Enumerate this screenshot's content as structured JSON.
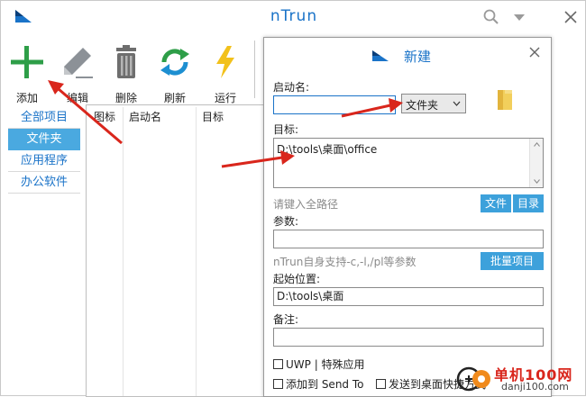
{
  "app": {
    "title": "nTrun"
  },
  "titlebar_icons": [
    "search-icon",
    "dropdown-icon",
    "close-icon"
  ],
  "toolbar": {
    "add_label": "添加",
    "edit_label": "编辑",
    "delete_label": "删除",
    "refresh_label": "刷新",
    "run_label": "运行"
  },
  "sidebar": {
    "items": [
      {
        "label": "全部项目"
      },
      {
        "label": "文件夹"
      },
      {
        "label": "应用程序"
      },
      {
        "label": "办公软件"
      }
    ]
  },
  "list": {
    "columns": [
      "图标",
      "启动名",
      "目标"
    ]
  },
  "dialog": {
    "title": "新建",
    "name_label": "启动名:",
    "name_value": "",
    "type_value": "文件夹",
    "target_label": "目标:",
    "target_value": "D:\\tools\\桌面\\office",
    "path_hint": "请键入全路径",
    "file_button": "文件",
    "dir_button": "目录",
    "args_label": "参数:",
    "args_value": "",
    "args_hint": "nTrun自身支持-c,-l,/pl等参数",
    "batch_button": "批量项目",
    "start_label": "起始位置:",
    "start_value": "D:\\tools\\桌面",
    "note_label": "备注:",
    "note_value": "",
    "uwp_label": "UWP | 特殊应用",
    "sendto_label": "添加到 Send To",
    "desktop_label": "发送到桌面快捷方式"
  },
  "watermark": {
    "line1": "单机100网",
    "line2": "danji100.com"
  },
  "colors": {
    "accent": "#1a73c8",
    "button": "#3da1db",
    "arrow": "#d9261c"
  }
}
